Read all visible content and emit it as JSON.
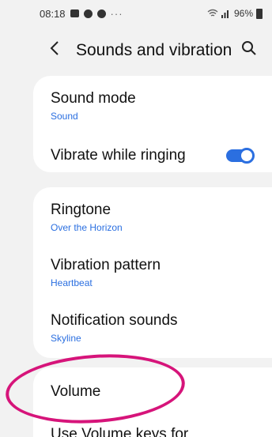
{
  "status_bar": {
    "time": "08:18",
    "overflow": "···",
    "battery": "96%",
    "icons": [
      "gallery-icon",
      "notification-dot-icon",
      "notification-dot-icon",
      "wifi-icon",
      "signal-icon",
      "battery-icon"
    ]
  },
  "header": {
    "title": "Sounds and vibration",
    "back_icon": "chevron-left-icon",
    "search_icon": "search-icon"
  },
  "group1": {
    "sound_mode": {
      "title": "Sound mode",
      "value": "Sound"
    },
    "vibrate_while_ringing": {
      "title": "Vibrate while ringing",
      "enabled": true
    }
  },
  "group2": {
    "ringtone": {
      "title": "Ringtone",
      "value": "Over the Horizon"
    },
    "vibration_pattern": {
      "title": "Vibration pattern",
      "value": "Heartbeat"
    },
    "notification_sounds": {
      "title": "Notification sounds",
      "value": "Skyline"
    }
  },
  "group3": {
    "volume": {
      "title": "Volume"
    },
    "volume_keys": {
      "title": "Use Volume keys for"
    }
  },
  "colors": {
    "accent": "#2b6fe0",
    "highlight": "#d6147a",
    "background": "#f2f2f2"
  }
}
